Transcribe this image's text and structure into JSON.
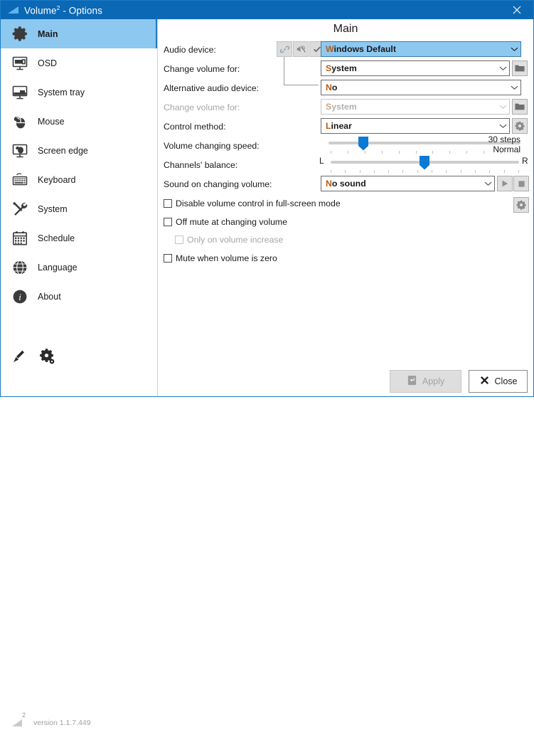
{
  "window": {
    "title": "Volume",
    "title_sup": "2",
    "title_suffix": " - Options",
    "close_icon": "close-icon",
    "accent": "#0a68b5",
    "selection": "#8dc8f0"
  },
  "sidebar": {
    "items": [
      {
        "label": "Main",
        "icon": "gear-icon",
        "selected": true
      },
      {
        "label": "OSD",
        "icon": "monitor-icon",
        "selected": false
      },
      {
        "label": "System tray",
        "icon": "systemtray-icon",
        "selected": false
      },
      {
        "label": "Mouse",
        "icon": "mouse-icon",
        "selected": false
      },
      {
        "label": "Screen edge",
        "icon": "screenedge-icon",
        "selected": false
      },
      {
        "label": "Keyboard",
        "icon": "keyboard-icon",
        "selected": false
      },
      {
        "label": "System",
        "icon": "tools-icon",
        "selected": false
      },
      {
        "label": "Schedule",
        "icon": "calendar-icon",
        "selected": false
      },
      {
        "label": "Language",
        "icon": "globe-icon",
        "selected": false
      },
      {
        "label": "About",
        "icon": "info-icon",
        "selected": false
      }
    ],
    "footer": {
      "tools": [
        {
          "icon": "paint-roller-icon"
        },
        {
          "icon": "gear-settings-icon"
        }
      ],
      "logo_sup": "2",
      "version": "version 1.1.7.449"
    }
  },
  "main": {
    "heading": "Main",
    "labels": {
      "audio_device": "Audio device:",
      "change_volume_for": "Change volume for:",
      "alternative_audio_device": "Alternative audio device:",
      "change_volume_for_alt": "Change volume for:",
      "control_method": "Control method:",
      "volume_changing_speed": "Volume changing speed:",
      "channels_balance": "Channels' balance:",
      "sound_on_changing_volume": "Sound on changing volume:"
    },
    "device_buttons": [
      {
        "icon": "link-icon",
        "name": "link-devices-button"
      },
      {
        "icon": "mute-icon",
        "name": "mute-device-button"
      },
      {
        "icon": "check-icon",
        "name": "confirm-device-button"
      }
    ],
    "fields": {
      "audio_device": {
        "value": "Windows Default",
        "hotkey": "W",
        "highlighted": true,
        "disabled": false
      },
      "change_volume_for": {
        "value": "System",
        "hotkey": "S",
        "highlighted": false,
        "disabled": false
      },
      "alternative_audio_device": {
        "value": "No",
        "hotkey": "N",
        "highlighted": false,
        "disabled": false
      },
      "change_volume_for_alt": {
        "value": "System",
        "hotkey": "S",
        "highlighted": false,
        "disabled": true
      },
      "control_method": {
        "value": "Linear",
        "hotkey": "L",
        "highlighted": false,
        "disabled": false
      },
      "sound_on_changing_volume": {
        "value": "No sound",
        "hotkey": "N",
        "highlighted": false,
        "disabled": false
      }
    },
    "side_buttons": {
      "browse_1": "folder-icon",
      "browse_2": "folder-icon",
      "control_method_settings": "gear-icon",
      "play": "play-icon",
      "stop": "stop-icon",
      "fullscreen_settings": "gear-icon"
    },
    "sliders": {
      "speed": {
        "value_text": "30 steps",
        "mode_text": "Normal",
        "position_pct": 22,
        "ticks": 12
      },
      "balance": {
        "left_label": "L",
        "right_label": "R",
        "position_pct": 50,
        "ticks": 14
      }
    },
    "checkboxes": [
      {
        "label": "Disable volume control in full-screen mode",
        "checked": false,
        "disabled": false,
        "indent": 0
      },
      {
        "label": "Off mute at changing volume",
        "checked": false,
        "disabled": false,
        "indent": 0
      },
      {
        "label": "Only on volume increase",
        "checked": false,
        "disabled": true,
        "indent": 1
      },
      {
        "label": "Mute when volume is zero",
        "checked": false,
        "disabled": false,
        "indent": 0
      }
    ]
  },
  "footer": {
    "apply": {
      "label": "Apply",
      "icon": "enter-key-icon",
      "disabled": true
    },
    "close": {
      "label": "Close",
      "icon": "x-icon",
      "disabled": false
    }
  }
}
